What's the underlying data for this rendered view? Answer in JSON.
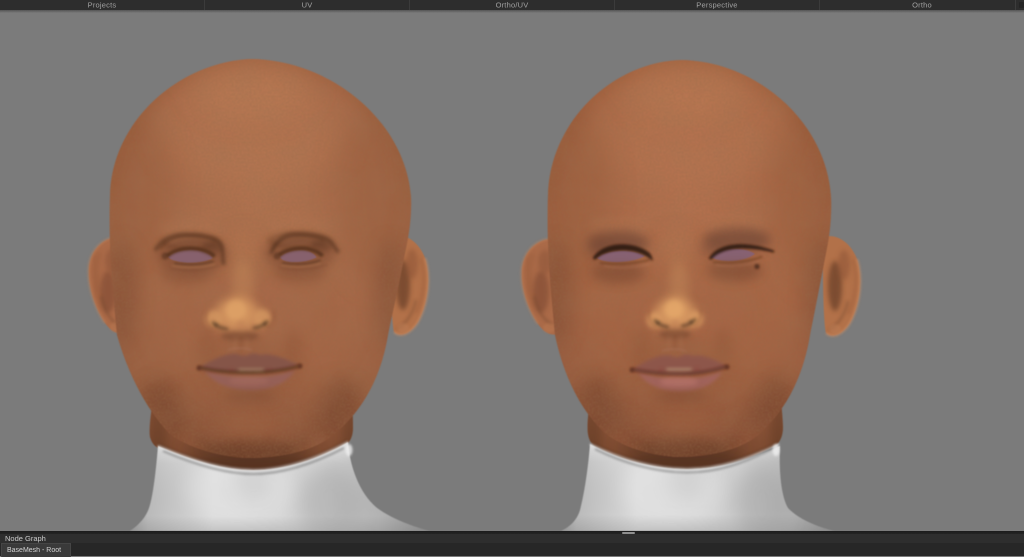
{
  "window": {
    "title": "3D character sculpting application"
  },
  "tabs": [
    {
      "label": "Projects"
    },
    {
      "label": "UV"
    },
    {
      "label": "Ortho/UV"
    },
    {
      "label": "Perspective"
    },
    {
      "label": "Ortho"
    }
  ],
  "viewport": {
    "description": "Two untextured-body bald human heads rendered side by side on a flat grey background",
    "background_color": "#7b7b7b",
    "models": [
      {
        "name": "head-left",
        "skin_tone": "#ad6b48",
        "eye_color": "#9b7380",
        "notes": "eyes closed slits, wide nose, parted lips with teeth glint, white clay neck"
      },
      {
        "name": "head-right",
        "skin_tone": "#b06a47",
        "eye_color": "#9e7280",
        "notes": "dark eyeliner, beauty mark right cheek, pink lips, white clay neck"
      }
    ]
  },
  "node_graph": {
    "title": "Node Graph",
    "root_node": "BaseMesh - Root"
  },
  "icons": {
    "tabbar_corner": "layout-menu-icon",
    "panel_splitter": "splitter-grip-icon"
  },
  "colors": {
    "tabbar_bg": "#2d2d2d",
    "tab_text": "#a2a2a2",
    "panel_header_bg": "#2e2e2e",
    "panel_canvas_bg": "#272727",
    "node_bg": "#3a3a3a",
    "viewport_grey": "#7b7b7b"
  }
}
